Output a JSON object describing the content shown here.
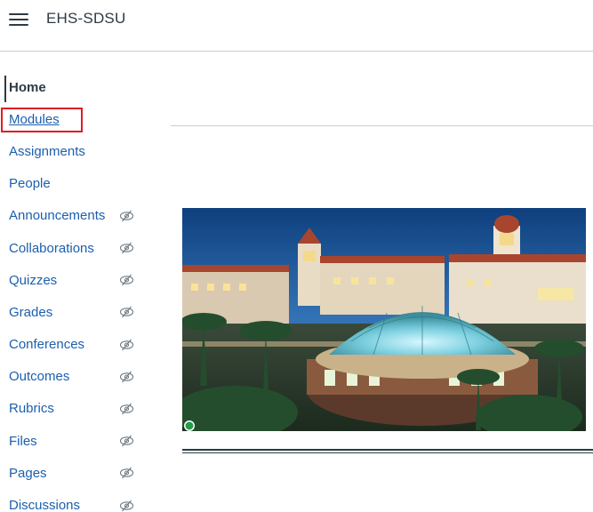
{
  "header": {
    "course_title": "EHS-SDSU"
  },
  "nav": {
    "items": [
      {
        "label": "Home",
        "hidden": false
      },
      {
        "label": "Modules",
        "hidden": false
      },
      {
        "label": "Assignments",
        "hidden": false
      },
      {
        "label": "People",
        "hidden": false
      },
      {
        "label": "Announcements",
        "hidden": true
      },
      {
        "label": "Collaborations",
        "hidden": true
      },
      {
        "label": "Quizzes",
        "hidden": true
      },
      {
        "label": "Grades",
        "hidden": true
      },
      {
        "label": "Conferences",
        "hidden": true
      },
      {
        "label": "Outcomes",
        "hidden": true
      },
      {
        "label": "Rubrics",
        "hidden": true
      },
      {
        "label": "Files",
        "hidden": true
      },
      {
        "label": "Pages",
        "hidden": true
      },
      {
        "label": "Discussions",
        "hidden": true
      }
    ]
  },
  "colors": {
    "link": "#1b5fae",
    "text": "#2d3b45",
    "highlight": "#e01b24",
    "eye_icon": "#6b7780"
  },
  "icons": {
    "menu": "hamburger-menu-icon",
    "hidden": "eye-slash-icon"
  }
}
